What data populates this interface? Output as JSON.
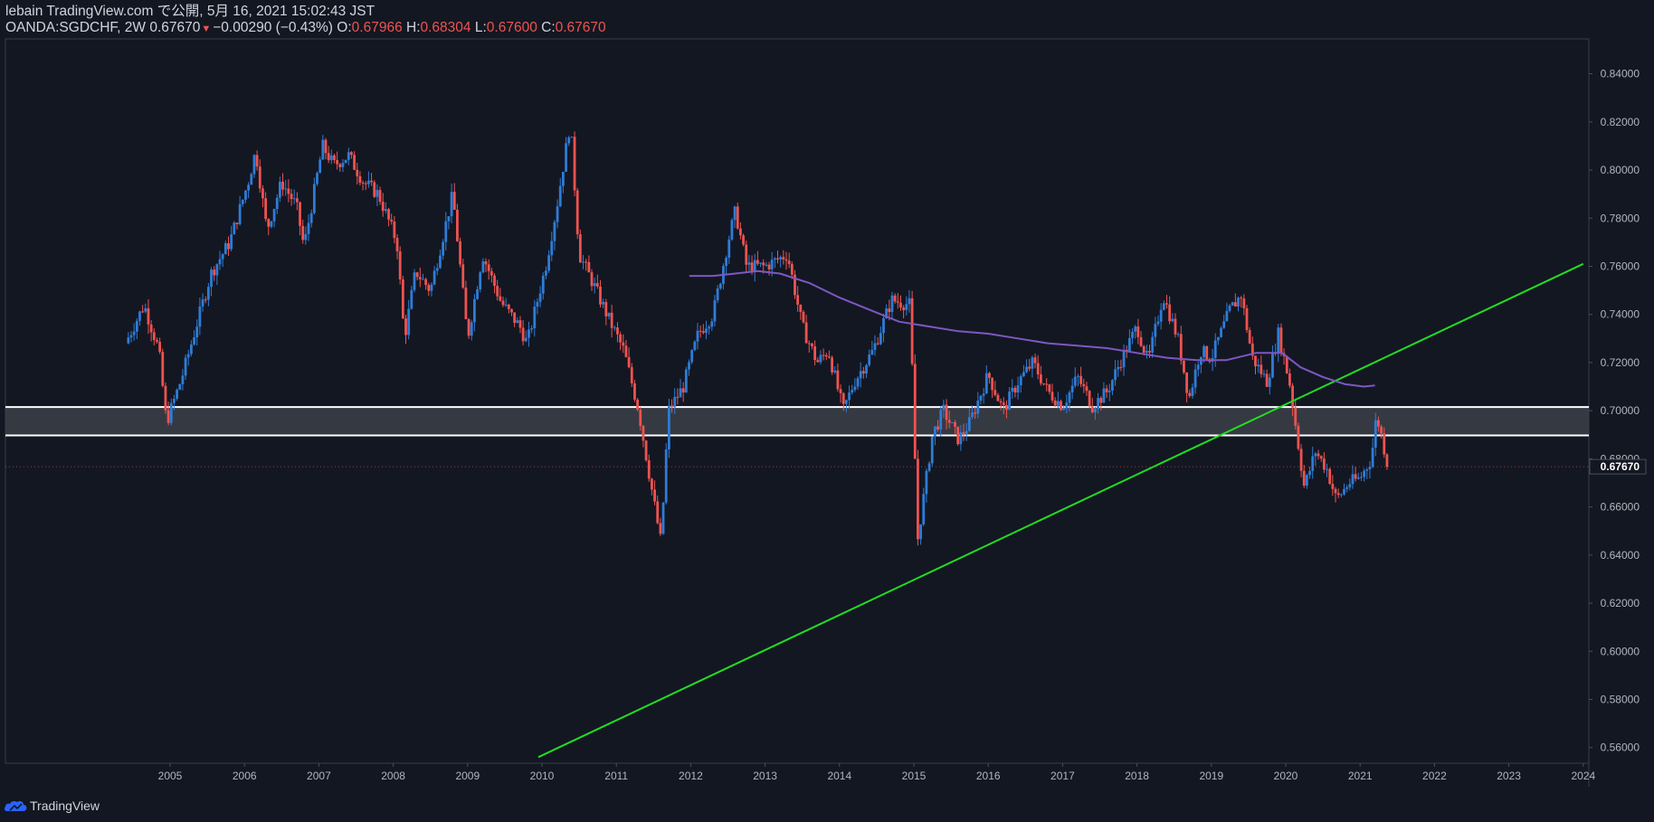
{
  "header": {
    "line1": "lebain TradingView.com で公開, 5月 16, 2021 15:02:43 JST",
    "symbol": "OANDA:SGDCHF, 2W",
    "last": "0.67670",
    "change": "−0.00290 (−0.43%)",
    "o_label": "O:",
    "o_value": "0.67966",
    "h_label": "H:",
    "h_value": "0.68304",
    "l_label": "L:",
    "l_value": "0.67600",
    "c_label": "C:",
    "c_value": "0.67670"
  },
  "footer": {
    "brand": "TradingView"
  },
  "colors": {
    "background": "#131722",
    "up": "#2e7cd6",
    "down": "#ef5350",
    "trendline": "#22dd22",
    "moving_average": "#7e57c2",
    "zone_fill": "#3a3d46",
    "zone_border": "#ffffff"
  },
  "chart_data": {
    "type": "candlestick",
    "symbol": "OANDA:SGDCHF",
    "interval": "2W",
    "xlim": [
      2004.35,
      2024.0
    ],
    "ylim": [
      0.5535,
      0.8545
    ],
    "x_ticks": [
      "2005",
      "2006",
      "2007",
      "2008",
      "2009",
      "2010",
      "2011",
      "2012",
      "2013",
      "2014",
      "2015",
      "2016",
      "2017",
      "2018",
      "2019",
      "2020",
      "2021",
      "2022",
      "2023",
      "2024"
    ],
    "y_ticks": [
      "0.84000",
      "0.82000",
      "0.80000",
      "0.78000",
      "0.76000",
      "0.74000",
      "0.72000",
      "0.70000",
      "0.68000",
      "0.66000",
      "0.64000",
      "0.62000",
      "0.60000",
      "0.58000",
      "0.56000"
    ],
    "last_price": "0.67670",
    "close_anchors": [
      [
        2004.4,
        0.728
      ],
      [
        2004.65,
        0.744
      ],
      [
        2004.85,
        0.725
      ],
      [
        2004.95,
        0.695
      ],
      [
        2005.15,
        0.713
      ],
      [
        2005.35,
        0.735
      ],
      [
        2005.55,
        0.757
      ],
      [
        2005.8,
        0.77
      ],
      [
        2006.05,
        0.795
      ],
      [
        2006.15,
        0.808
      ],
      [
        2006.3,
        0.775
      ],
      [
        2006.5,
        0.795
      ],
      [
        2006.7,
        0.785
      ],
      [
        2006.8,
        0.768
      ],
      [
        2007.05,
        0.81
      ],
      [
        2007.2,
        0.802
      ],
      [
        2007.4,
        0.806
      ],
      [
        2007.6,
        0.795
      ],
      [
        2007.8,
        0.79
      ],
      [
        2008.05,
        0.77
      ],
      [
        2008.15,
        0.73
      ],
      [
        2008.3,
        0.758
      ],
      [
        2008.5,
        0.75
      ],
      [
        2008.8,
        0.79
      ],
      [
        2009.0,
        0.73
      ],
      [
        2009.2,
        0.765
      ],
      [
        2009.45,
        0.745
      ],
      [
        2009.7,
        0.735
      ],
      [
        2009.8,
        0.728
      ],
      [
        2010.05,
        0.76
      ],
      [
        2010.2,
        0.785
      ],
      [
        2010.38,
        0.82
      ],
      [
        2010.5,
        0.765
      ],
      [
        2010.7,
        0.752
      ],
      [
        2010.9,
        0.738
      ],
      [
        2011.1,
        0.725
      ],
      [
        2011.3,
        0.7
      ],
      [
        2011.45,
        0.672
      ],
      [
        2011.6,
        0.645
      ],
      [
        2011.7,
        0.7
      ],
      [
        2011.9,
        0.71
      ],
      [
        2012.1,
        0.732
      ],
      [
        2012.3,
        0.74
      ],
      [
        2012.5,
        0.77
      ],
      [
        2012.6,
        0.783
      ],
      [
        2012.75,
        0.76
      ],
      [
        2013.0,
        0.76
      ],
      [
        2013.3,
        0.765
      ],
      [
        2013.5,
        0.735
      ],
      [
        2013.7,
        0.72
      ],
      [
        2013.85,
        0.725
      ],
      [
        2014.05,
        0.7
      ],
      [
        2014.2,
        0.712
      ],
      [
        2014.45,
        0.725
      ],
      [
        2014.7,
        0.746
      ],
      [
        2014.95,
        0.744
      ],
      [
        2015.05,
        0.646
      ],
      [
        2015.25,
        0.69
      ],
      [
        2015.4,
        0.7
      ],
      [
        2015.6,
        0.688
      ],
      [
        2015.75,
        0.695
      ],
      [
        2016.0,
        0.715
      ],
      [
        2016.2,
        0.7
      ],
      [
        2016.4,
        0.712
      ],
      [
        2016.6,
        0.72
      ],
      [
        2016.8,
        0.708
      ],
      [
        2017.0,
        0.702
      ],
      [
        2017.2,
        0.714
      ],
      [
        2017.4,
        0.702
      ],
      [
        2017.6,
        0.708
      ],
      [
        2017.8,
        0.722
      ],
      [
        2018.0,
        0.735
      ],
      [
        2018.15,
        0.72
      ],
      [
        2018.35,
        0.748
      ],
      [
        2018.55,
        0.73
      ],
      [
        2018.7,
        0.705
      ],
      [
        2018.85,
        0.725
      ],
      [
        2019.0,
        0.722
      ],
      [
        2019.25,
        0.742
      ],
      [
        2019.4,
        0.748
      ],
      [
        2019.55,
        0.722
      ],
      [
        2019.75,
        0.712
      ],
      [
        2019.9,
        0.732
      ],
      [
        2020.05,
        0.712
      ],
      [
        2020.15,
        0.69
      ],
      [
        2020.25,
        0.668
      ],
      [
        2020.4,
        0.683
      ],
      [
        2020.55,
        0.676
      ],
      [
        2020.68,
        0.663
      ],
      [
        2020.85,
        0.67
      ],
      [
        2021.0,
        0.672
      ],
      [
        2021.15,
        0.68
      ],
      [
        2021.22,
        0.698
      ],
      [
        2021.3,
        0.688
      ],
      [
        2021.37,
        0.6767
      ]
    ],
    "series": [
      {
        "name": "",
        "type": "line",
        "style": "trendline",
        "points": [
          [
            2009.95,
            0.556
          ],
          [
            2024.0,
            0.761
          ]
        ]
      },
      {
        "name": "",
        "type": "line",
        "style": "moving_average",
        "points": [
          [
            2011.98,
            0.756
          ],
          [
            2012.3,
            0.756
          ],
          [
            2012.6,
            0.757
          ],
          [
            2012.9,
            0.758
          ],
          [
            2013.2,
            0.757
          ],
          [
            2013.6,
            0.753
          ],
          [
            2014.0,
            0.747
          ],
          [
            2014.4,
            0.742
          ],
          [
            2014.8,
            0.737
          ],
          [
            2015.2,
            0.735
          ],
          [
            2015.6,
            0.733
          ],
          [
            2016.0,
            0.732
          ],
          [
            2016.4,
            0.73
          ],
          [
            2016.8,
            0.728
          ],
          [
            2017.2,
            0.727
          ],
          [
            2017.6,
            0.726
          ],
          [
            2018.0,
            0.724
          ],
          [
            2018.4,
            0.722
          ],
          [
            2018.8,
            0.721
          ],
          [
            2019.2,
            0.721
          ],
          [
            2019.6,
            0.724
          ],
          [
            2019.95,
            0.724
          ],
          [
            2020.2,
            0.718
          ],
          [
            2020.5,
            0.714
          ],
          [
            2020.8,
            0.711
          ],
          [
            2021.05,
            0.71
          ],
          [
            2021.2,
            0.7105
          ]
        ]
      }
    ],
    "zone": {
      "top": 0.7015,
      "bottom": 0.6897
    },
    "grid": false
  }
}
